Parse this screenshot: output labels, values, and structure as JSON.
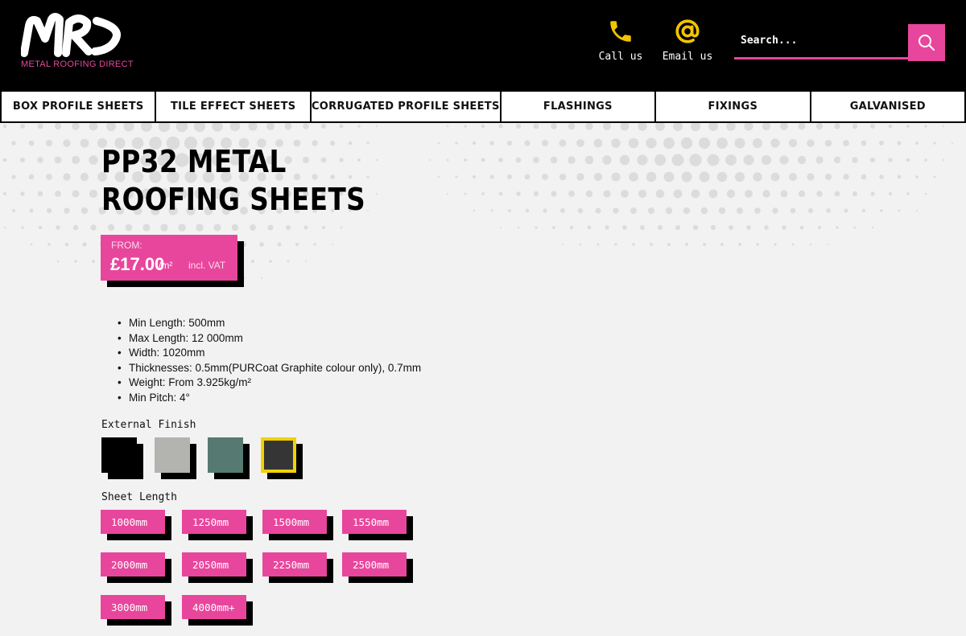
{
  "header": {
    "logo_text": "METAL ROOFING DIRECT",
    "call_label": "Call us",
    "email_label": "Email us",
    "search_placeholder": "Search..."
  },
  "nav": {
    "items": [
      {
        "label": "BOX PROFILE SHEETS"
      },
      {
        "label": "TILE EFFECT SHEETS"
      },
      {
        "label": "CORRUGATED PROFILE SHEETS"
      },
      {
        "label": "FLASHINGS"
      },
      {
        "label": "FIXINGS"
      },
      {
        "label": "GALVANISED"
      }
    ]
  },
  "product": {
    "title": "PP32 METAL ROOFING SHEETS",
    "price_from": "FROM:",
    "price": "£17.00",
    "price_unit": "/m²",
    "price_vat": "incl. VAT",
    "specs": [
      "Min Length: 500mm",
      "Max Length: 12 000mm",
      "Width: 1020mm",
      "Thicknesses: 0.5mm(PURCoat Graphite colour only), 0.7mm",
      "Weight: From 3.925kg/m²",
      "Min Pitch: 4°"
    ]
  },
  "finish": {
    "label": "External Finish",
    "swatches": [
      {
        "color": "#000000",
        "selected": false
      },
      {
        "color": "#b3b3b0",
        "selected": false
      },
      {
        "color": "#567a71",
        "selected": false
      },
      {
        "color": "#353535",
        "selected": true
      }
    ]
  },
  "length": {
    "label": "Sheet Length",
    "options": [
      "1000mm",
      "1250mm",
      "1500mm",
      "1550mm",
      "2000mm",
      "2050mm",
      "2250mm",
      "2500mm",
      "3000mm",
      "4000mm+"
    ]
  },
  "colors": {
    "brand_pink": "#e8469c",
    "accent_yellow": "#f2d100",
    "header_bg": "#000000"
  },
  "icons": [
    "phone-icon",
    "at-sign-icon",
    "search-icon"
  ]
}
